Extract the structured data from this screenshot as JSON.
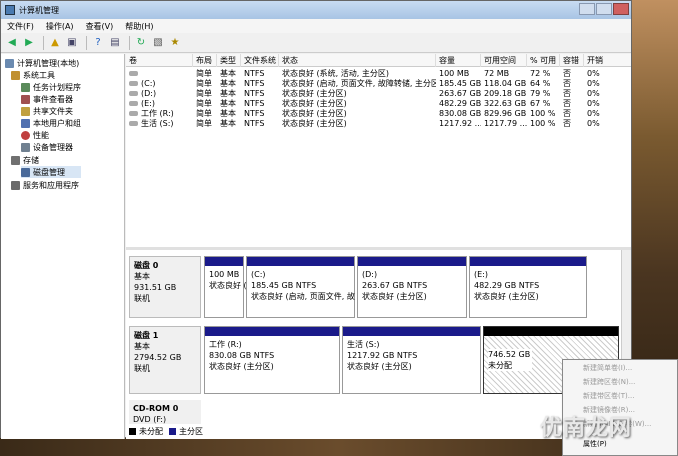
{
  "window": {
    "title": "计算机管理"
  },
  "menu": [
    "文件(F)",
    "操作(A)",
    "查看(V)",
    "帮助(H)"
  ],
  "tree": [
    {
      "label": "计算机管理(本地)",
      "color": "#6a8ab0"
    },
    {
      "label": "系统工具",
      "color": "#c09030"
    },
    {
      "label": "任务计划程序",
      "color": "#5a8a5a"
    },
    {
      "label": "事件查看器",
      "color": "#a05050"
    },
    {
      "label": "共享文件夹",
      "color": "#c0a040"
    },
    {
      "label": "本地用户和组",
      "color": "#5070b0"
    },
    {
      "label": "性能",
      "color": "#c04040"
    },
    {
      "label": "设备管理器",
      "color": "#708090"
    },
    {
      "label": "存储",
      "color": "#707070"
    },
    {
      "label": "磁盘管理",
      "color": "#4a6a9a"
    },
    {
      "label": "服务和应用程序",
      "color": "#6a6a6a"
    }
  ],
  "columns": [
    "卷",
    "布局",
    "类型",
    "文件系统",
    "状态",
    "容量",
    "可用空间",
    "% 可用",
    "容错",
    "开销"
  ],
  "volumes": [
    [
      "",
      "简单",
      "基本",
      "NTFS",
      "状态良好 (系统, 活动, 主分区)",
      "100 MB",
      "72 MB",
      "72 %",
      "否",
      "0%"
    ],
    [
      "(C:)",
      "简单",
      "基本",
      "NTFS",
      "状态良好 (启动, 页面文件, 故障转储, 主分区)",
      "185.45 GB",
      "118.04 GB",
      "64 %",
      "否",
      "0%"
    ],
    [
      "(D:)",
      "简单",
      "基本",
      "NTFS",
      "状态良好 (主分区)",
      "263.67 GB",
      "209.18 GB",
      "79 %",
      "否",
      "0%"
    ],
    [
      "(E:)",
      "简单",
      "基本",
      "NTFS",
      "状态良好 (主分区)",
      "482.29 GB",
      "322.63 GB",
      "67 %",
      "否",
      "0%"
    ],
    [
      "工作 (R:)",
      "简单",
      "基本",
      "NTFS",
      "状态良好 (主分区)",
      "830.08 GB",
      "829.96 GB",
      "100 %",
      "否",
      "0%"
    ],
    [
      "生活 (S:)",
      "简单",
      "基本",
      "NTFS",
      "状态良好 (主分区)",
      "1217.92 ...",
      "1217.79 ...",
      "100 %",
      "否",
      "0%"
    ]
  ],
  "disk0": {
    "name": "磁盘 0",
    "type": "基本",
    "size": "931.51 GB",
    "state": "联机",
    "parts": [
      {
        "title": "",
        "size": "100 MB",
        "status": "状态良好 (主分区)"
      },
      {
        "title": "(C:)",
        "size": "185.45 GB NTFS",
        "status": "状态良好 (启动, 页面文件, 故"
      },
      {
        "title": "(D:)",
        "size": "263.67 GB NTFS",
        "status": "状态良好 (主分区)"
      },
      {
        "title": "(E:)",
        "size": "482.29 GB NTFS",
        "status": "状态良好 (主分区)"
      }
    ]
  },
  "disk1": {
    "name": "磁盘 1",
    "type": "基本",
    "size": "2794.52 GB",
    "state": "联机",
    "parts": [
      {
        "title": "工作 (R:)",
        "size": "830.08 GB NTFS",
        "status": "状态良好 (主分区)"
      },
      {
        "title": "生活 (S:)",
        "size": "1217.92 GB NTFS",
        "status": "状态良好 (主分区)"
      },
      {
        "title": "",
        "size": "746.52 GB",
        "status": "未分配"
      }
    ]
  },
  "cdrom": {
    "name": "CD-ROM 0",
    "type": "DVD (F:)"
  },
  "legend": {
    "unalloc": "未分配",
    "primary": "主分区"
  },
  "context_menu": [
    "新建简单卷(I)...",
    "新建跨区卷(N)...",
    "新建带区卷(T)...",
    "新建镜像卷(R)...",
    "新建 RAID-5 卷(W)...",
    "属性(P)"
  ],
  "watermark": "优南龙网"
}
